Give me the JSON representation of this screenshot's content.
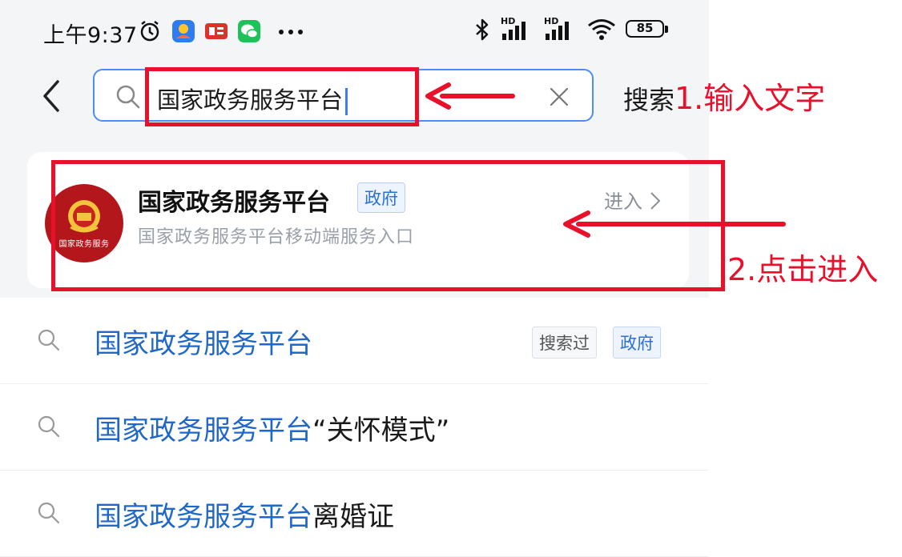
{
  "status_bar": {
    "time": "上午9:37",
    "hd1": "HD",
    "hd2": "HD",
    "battery": "85"
  },
  "search": {
    "query": "国家政务服务平台",
    "search_button": "搜索"
  },
  "result": {
    "title": "国家政务服务平台",
    "tag": "政府",
    "enter_label": "进入",
    "subtitle": "国家政务服务平台移动端服务入口",
    "logo_text": "国家政务服务"
  },
  "suggestions": [
    {
      "highlight": "国家政务服务平台",
      "rest": "",
      "badges": [
        "搜索过",
        "政府"
      ]
    },
    {
      "highlight": "国家政务服务平台",
      "rest": "“关怀模式”",
      "badges": []
    },
    {
      "highlight": "国家政务服务平台",
      "rest": "离婚证",
      "badges": []
    }
  ],
  "annotations": {
    "step1": "1.输入文字",
    "step2": "2.点击进入",
    "color": "#e8102a"
  }
}
